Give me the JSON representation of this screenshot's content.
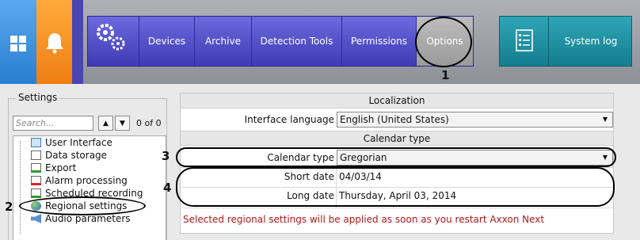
{
  "topbar": {
    "nav_items": [
      "Devices",
      "Archive",
      "Detection Tools",
      "Permissions",
      "Options"
    ],
    "system_log": "System log"
  },
  "settings": {
    "title": "Settings",
    "search_placeholder": "Search...",
    "counter": "0 of 0",
    "tree_items": [
      "User Interface",
      "Data storage",
      "Export",
      "Alarm processing",
      "Scheduled recording",
      "Regional settings",
      "Audio parameters"
    ],
    "selected_item": "Regional settings"
  },
  "localization": {
    "header": "Localization",
    "interface_language_label": "Interface language",
    "interface_language_value": "English (United States)"
  },
  "calendar": {
    "header": "Calendar type",
    "calendar_type_label": "Calendar type",
    "calendar_type_value": "Gregorian",
    "short_date_label": "Short date",
    "short_date_value": "04/03/14",
    "long_date_label": "Long date",
    "long_date_value": "Thursday, April 03, 2014"
  },
  "notice": "Selected regional settings will be applied as soon as you restart Axxon Next",
  "annotations": [
    "1",
    "2",
    "3",
    "4"
  ],
  "colors": {
    "nav": "#4c49c4",
    "options_selected": "#a8a8a8",
    "syslog": "#1e8e9f",
    "notice": "#b21818"
  }
}
